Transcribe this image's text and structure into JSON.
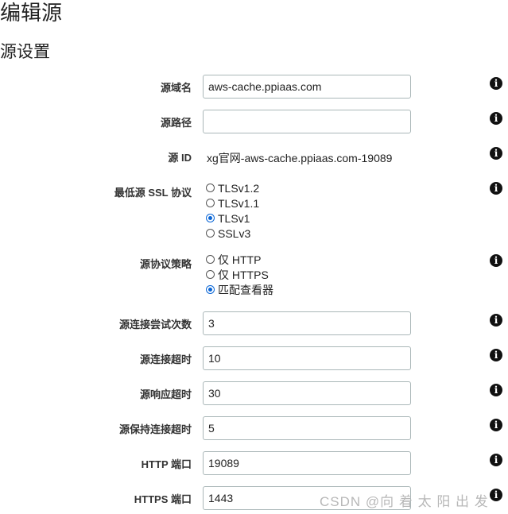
{
  "page": {
    "title": "编辑源",
    "section_title": "源设置"
  },
  "fields": {
    "origin_domain": {
      "label": "源域名",
      "value": "aws-cache.ppiaas.com"
    },
    "origin_path": {
      "label": "源路径",
      "value": ""
    },
    "origin_id": {
      "label": "源 ID",
      "value": "xg官网-aws-cache.ppiaas.com-19089"
    },
    "min_ssl": {
      "label": "最低源 SSL 协议",
      "options": [
        "TLSv1.2",
        "TLSv1.1",
        "TLSv1",
        "SSLv3"
      ],
      "selected": "TLSv1"
    },
    "protocol_policy": {
      "label": "源协议策略",
      "options": [
        "仅 HTTP",
        "仅 HTTPS",
        "匹配查看器"
      ],
      "selected": "匹配查看器"
    },
    "conn_attempts": {
      "label": "源连接尝试次数",
      "value": "3"
    },
    "conn_timeout": {
      "label": "源连接超时",
      "value": "10"
    },
    "response_timeout": {
      "label": "源响应超时",
      "value": "30"
    },
    "keepalive_timeout": {
      "label": "源保持连接超时",
      "value": "5"
    },
    "http_port": {
      "label": "HTTP 端口",
      "value": "19089"
    },
    "https_port": {
      "label": "HTTPS 端口",
      "value": "1443"
    }
  },
  "icons": {
    "info": "info-icon",
    "info_glyph": "i"
  },
  "watermark": "CSDN @向 着 太 阳 出 发"
}
